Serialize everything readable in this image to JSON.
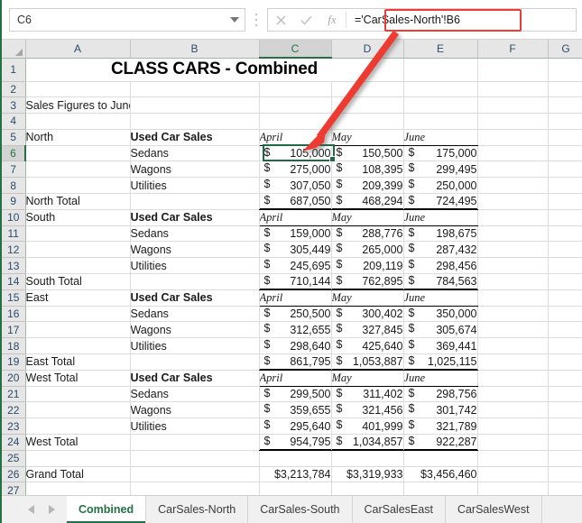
{
  "formula_bar": {
    "name_box_value": "C6",
    "formula_value": "='CarSales-North'!B6",
    "cancel_icon": "close-icon",
    "confirm_icon": "check-icon",
    "function_icon": "fx-icon",
    "dropdown_icon": "chevron-down-icon"
  },
  "grid": {
    "column_headers": [
      "A",
      "B",
      "C",
      "D",
      "E",
      "F",
      "G"
    ],
    "selected_column": "C",
    "selected_row": "6",
    "row_numbers": [
      "1",
      "2",
      "3",
      "4",
      "5",
      "6",
      "7",
      "8",
      "9",
      "10",
      "11",
      "12",
      "13",
      "14",
      "15",
      "16",
      "17",
      "18",
      "19",
      "20",
      "21",
      "22",
      "23",
      "24",
      "25",
      "26",
      "27"
    ],
    "title": "CLASS CARS - Combined",
    "subtitle": "Sales Figures to June",
    "section_label": "Used Car Sales",
    "months": [
      "April",
      "May",
      "June"
    ],
    "rows": {
      "r3_a": "Sales Figures to June",
      "r5_a": "North",
      "r6_b": "Sedans",
      "r6_c": "105,000",
      "r6_d": "150,500",
      "r6_e": "175,000",
      "r7_b": "Wagons",
      "r7_c": "275,000",
      "r7_d": "108,395",
      "r7_e": "299,495",
      "r8_b": "Utilities",
      "r8_c": "307,050",
      "r8_d": "209,399",
      "r8_e": "250,000",
      "r9_a": "North Total",
      "r9_c": "687,050",
      "r9_d": "468,294",
      "r9_e": "724,495",
      "r10_a": "South",
      "r11_b": "Sedans",
      "r11_c": "159,000",
      "r11_d": "288,776",
      "r11_e": "198,675",
      "r12_b": "Wagons",
      "r12_c": "305,449",
      "r12_d": "265,000",
      "r12_e": "287,432",
      "r13_b": "Utilities",
      "r13_c": "245,695",
      "r13_d": "209,119",
      "r13_e": "298,456",
      "r14_a": "South Total",
      "r14_c": "710,144",
      "r14_d": "762,895",
      "r14_e": "784,563",
      "r15_a": "East",
      "r16_b": "Sedans",
      "r16_c": "250,500",
      "r16_d": "300,402",
      "r16_e": "350,000",
      "r17_b": "Wagons",
      "r17_c": "312,655",
      "r17_d": "327,845",
      "r17_e": "305,674",
      "r18_b": "Utilities",
      "r18_c": "298,640",
      "r18_d": "425,640",
      "r18_e": "369,441",
      "r19_a": "East Total",
      "r19_c": "861,795",
      "r19_d": "1,053,887",
      "r19_e": "1,025,115",
      "r20_a": "West Total",
      "r21_b": "Sedans",
      "r21_c": "299,500",
      "r21_d": "311,402",
      "r21_e": "298,756",
      "r22_b": "Wagons",
      "r22_c": "359,655",
      "r22_d": "321,456",
      "r22_e": "301,742",
      "r23_b": "Utilities",
      "r23_c": "295,640",
      "r23_d": "401,999",
      "r23_e": "321,789",
      "r24_a": "West Total",
      "r24_c": "954,795",
      "r24_d": "1,034,857",
      "r24_e": "922,287",
      "r26_a": "Grand Total",
      "r26_c": "$3,213,784",
      "r26_d": "$3,319,933",
      "r26_e": "$3,456,460"
    },
    "currency_symbol": "$"
  },
  "tab_bar": {
    "prev_icon": "triangle-left-icon",
    "next_icon": "triangle-right-icon",
    "tabs": [
      {
        "label": "Combined",
        "active": true
      },
      {
        "label": "CarSales-North",
        "active": false
      },
      {
        "label": "CarSales-South",
        "active": false
      },
      {
        "label": "CarSalesEast",
        "active": false
      },
      {
        "label": "CarSalesWest",
        "active": false
      }
    ]
  },
  "annotation": {
    "highlight_color": "#ee3b33",
    "arrow_label": "red-arrow-pointing-to-selected-cell"
  },
  "colors": {
    "accent_green": "#217346",
    "selection_border": "#1e6b43",
    "header_gray": "#e6e6e6",
    "gridline": "#dcdcdc"
  }
}
